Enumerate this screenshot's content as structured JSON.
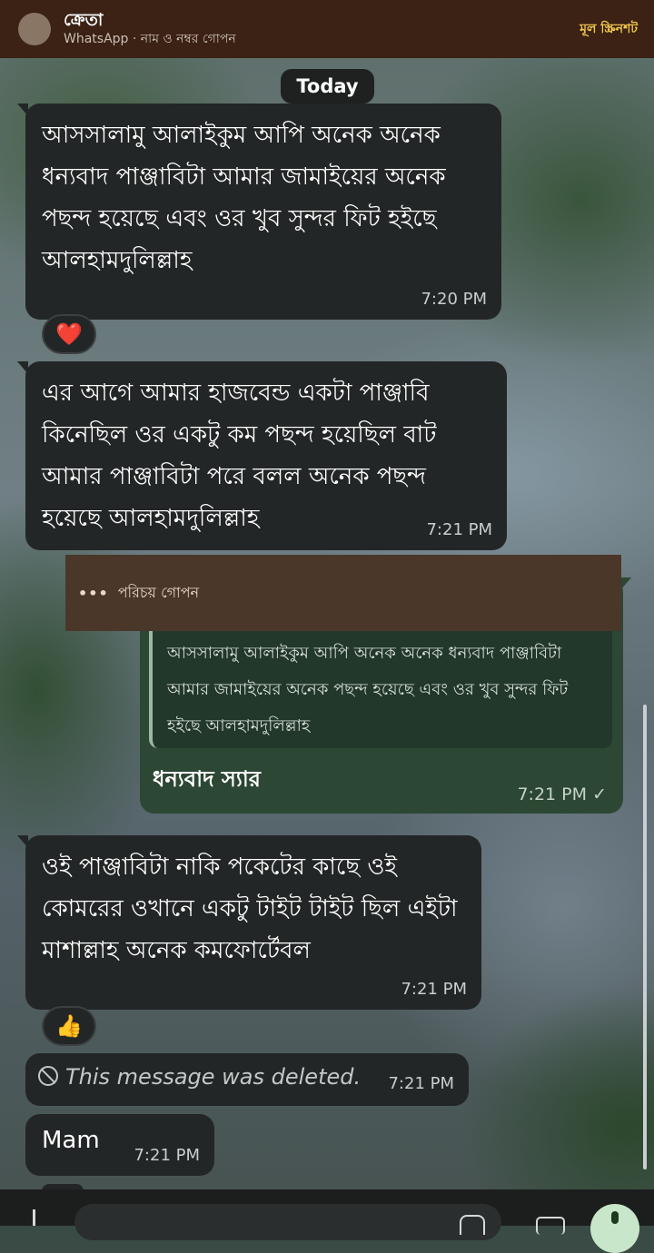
{
  "header": {
    "title": "ক্রেতা",
    "subtitle": "WhatsApp · নাম ও নম্বর গোপন",
    "link_label": "মূল স্ক্রিনশট"
  },
  "date_chip": "Today",
  "messages": [
    {
      "text": "আসসালামু আলাইকুম আপি অনেক অনেক ধন্যবাদ পাঞ্জাবিটা আমার জামাইয়ের অনেক পছন্দ হয়েছে এবং ওর খুব সুন্দর ফিট হইছে আলহামদুলিল্লাহ",
      "time": "7:20 PM",
      "reaction": "❤️"
    },
    {
      "text": "এর আগে আমার হাজবেন্ড একটা পাঞ্জাবি কিনেছিল ওর একটু কম পছন্দ হয়েছিল বাট আমার পাঞ্জাবিটা পরে বলল অনেক পছন্দ হয়েছে আলহামদুলিল্লাহ",
      "time": "7:21 PM"
    },
    {
      "text": "ওই পাঞ্জাবিটা নাকি পকেটের কাছে ওই কোমরের ওখানে একটু টাইট টাইট ছিল এইটা মাশাল্লাহ অনেক কমফোর্টেবল",
      "time": "7:21 PM",
      "reaction": "👍"
    },
    {
      "text": "This message was deleted.",
      "time": "7:21 PM"
    },
    {
      "text": "Mam",
      "time": "7:21 PM"
    }
  ],
  "outgoing": {
    "identity_label": "পরিচয় গোপন",
    "quoted_text": "আসসালামু আলাইকুম আপি অনেক অনেক ধন্যবাদ পাঞ্জাবিটা আমার জামাইয়ের অনেক পছন্দ হয়েছে এবং ওর খুব সুন্দর ফিট হইছে আলহামদুলিল্লাহ",
    "text": "ধন্যবাদ স্যার",
    "time": "7:21 PM",
    "status": "✓"
  },
  "icons": {
    "identity": "more-dots-icon",
    "deleted": "ban-icon",
    "attach": "plus-icon",
    "sticker": "sticker-icon",
    "camera": "camera-icon",
    "mic": "mic-icon"
  }
}
